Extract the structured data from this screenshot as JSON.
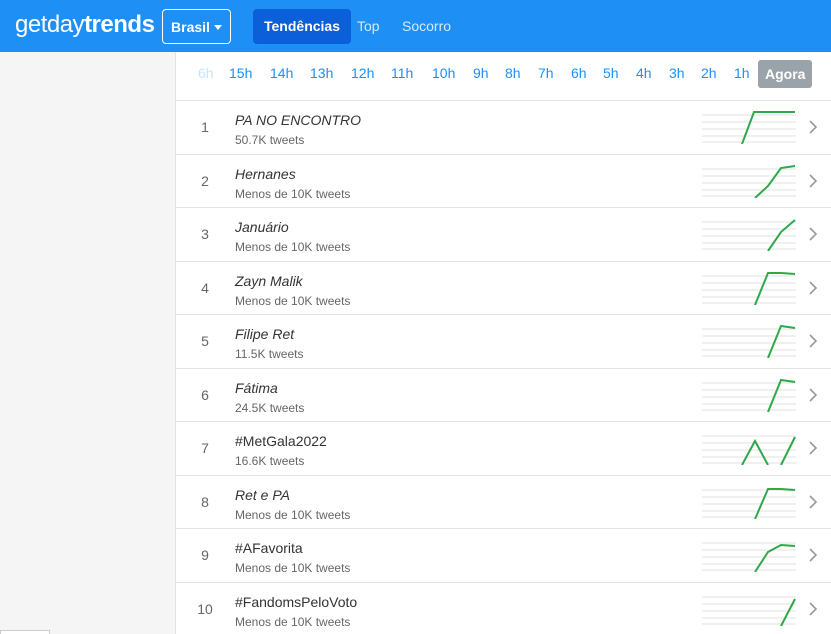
{
  "header": {
    "logo_light": "getday",
    "logo_bold": "trends",
    "country": "Brasil",
    "nav": [
      {
        "label": "Tendências",
        "active": true
      },
      {
        "label": "Top",
        "active": false
      },
      {
        "label": "Socorro",
        "active": false
      }
    ]
  },
  "timebar": {
    "items": [
      "6h",
      "15h",
      "14h",
      "13h",
      "12h",
      "11h",
      "10h",
      "9h",
      "8h",
      "7h",
      "6h",
      "5h",
      "4h",
      "3h",
      "2h",
      "1h",
      "Agora"
    ],
    "selected": "Agora"
  },
  "trends": [
    {
      "rank": "1",
      "name": "PA NO ENCONTRO",
      "volume": "50.7K tweets",
      "italic": true
    },
    {
      "rank": "2",
      "name": "Hernanes",
      "volume": "Menos de 10K tweets",
      "italic": true
    },
    {
      "rank": "3",
      "name": "Januário",
      "volume": "Menos de 10K tweets",
      "italic": true
    },
    {
      "rank": "4",
      "name": "Zayn Malik",
      "volume": "Menos de 10K tweets",
      "italic": true
    },
    {
      "rank": "5",
      "name": "Filipe Ret",
      "volume": "11.5K tweets",
      "italic": true
    },
    {
      "rank": "6",
      "name": "Fátima",
      "volume": "24.5K tweets",
      "italic": true
    },
    {
      "rank": "7",
      "name": "#MetGala2022",
      "volume": "16.6K tweets",
      "italic": false
    },
    {
      "rank": "8",
      "name": "Ret e PA",
      "volume": "Menos de 10K tweets",
      "italic": true
    },
    {
      "rank": "9",
      "name": "#AFavorita",
      "volume": "Menos de 10K tweets",
      "italic": false
    },
    {
      "rank": "10",
      "name": "#FandomsPeloVoto",
      "volume": "Menos de 10K tweets",
      "italic": false
    }
  ],
  "colors": {
    "navbar": "#1e8ff5",
    "active_nav": "#0b5fd9",
    "link": "#1e8ff5",
    "sparkline": "#2ea84a"
  }
}
